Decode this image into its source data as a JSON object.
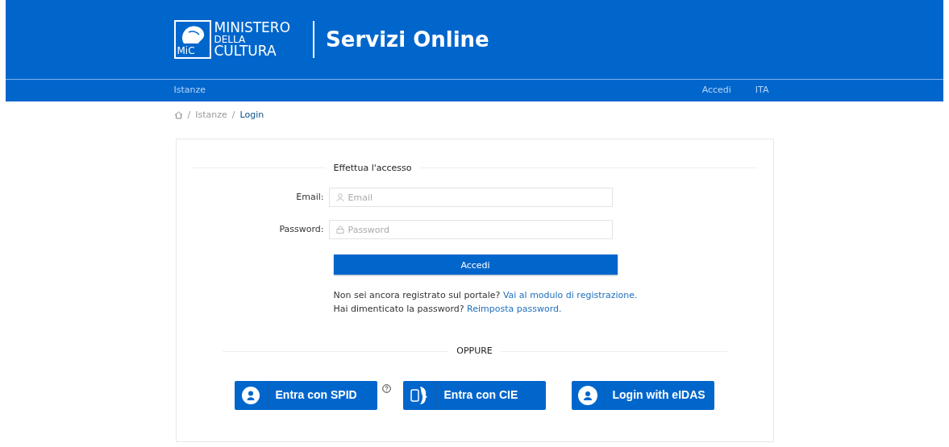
{
  "header": {
    "logo_mark": "MiC",
    "logo_lines": [
      "MINISTERO",
      "DELLA",
      "CULTURA"
    ],
    "title": "Servizi Online"
  },
  "nav": {
    "left": [
      {
        "label": "Istanze"
      }
    ],
    "right": [
      {
        "label": "Accedi"
      },
      {
        "label": "ITA"
      }
    ]
  },
  "breadcrumb": [
    {
      "separator": "/",
      "label": "Istanze",
      "current": false
    },
    {
      "separator": "/",
      "label": "Login",
      "current": true
    }
  ],
  "login": {
    "legend": "Effettua l'accesso",
    "fields": [
      {
        "kind": "email",
        "label": "Email:",
        "placeholder": "Email"
      },
      {
        "kind": "password",
        "label": "Password:",
        "placeholder": "Password"
      }
    ],
    "submit": "Accedi",
    "help": [
      {
        "text": "Non sei ancora registrato sul portale?",
        "link": "Vai al modulo di registrazione."
      },
      {
        "text": "Hai dimenticato la password?",
        "link": "Reimposta password."
      }
    ]
  },
  "alternatives": {
    "divider": "OPPURE",
    "buttons": [
      {
        "kind": "spid",
        "label": "Entra con SPID",
        "help": true
      },
      {
        "kind": "cie",
        "label": "Entra con CIE",
        "help": false
      },
      {
        "kind": "eidas",
        "label": "Login with eIDAS",
        "help": false
      }
    ]
  }
}
